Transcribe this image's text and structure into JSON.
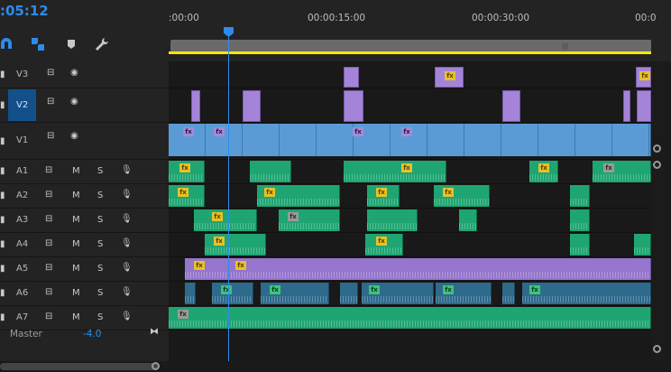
{
  "timecode": ":05:12",
  "ruler": {
    "ticks": [
      ":00:00",
      "00:00:15:00",
      "00:00:30:00",
      "00:0"
    ]
  },
  "icons": [
    "snap-magnet-icon",
    "linked-selection-icon",
    "add-marker-icon",
    "wrench-icon"
  ],
  "tracks": [
    {
      "id": "V3",
      "name": "V3"
    },
    {
      "id": "V2",
      "name": "V2"
    },
    {
      "id": "V1",
      "name": "V1"
    },
    {
      "id": "A1",
      "name": "A1",
      "mute": "M",
      "solo": "S"
    },
    {
      "id": "A2",
      "name": "A2",
      "mute": "M",
      "solo": "S"
    },
    {
      "id": "A3",
      "name": "A3",
      "mute": "M",
      "solo": "S"
    },
    {
      "id": "A4",
      "name": "A4",
      "mute": "M",
      "solo": "S"
    },
    {
      "id": "A5",
      "name": "A5",
      "mute": "M",
      "solo": "S"
    },
    {
      "id": "A6",
      "name": "A6",
      "mute": "M",
      "solo": "S"
    },
    {
      "id": "A7",
      "name": "A7",
      "mute": "M",
      "solo": "S"
    }
  ],
  "master": {
    "label": "Master",
    "value": "-4.0"
  },
  "fx_label": "fx",
  "colors": {
    "accent": "#2d8ceb",
    "video": "#5b9bd5",
    "adjust": "#a484d8",
    "audio": "#1fa571",
    "audio_alt": "#2e6a8c",
    "work_area": "#ffe600"
  }
}
